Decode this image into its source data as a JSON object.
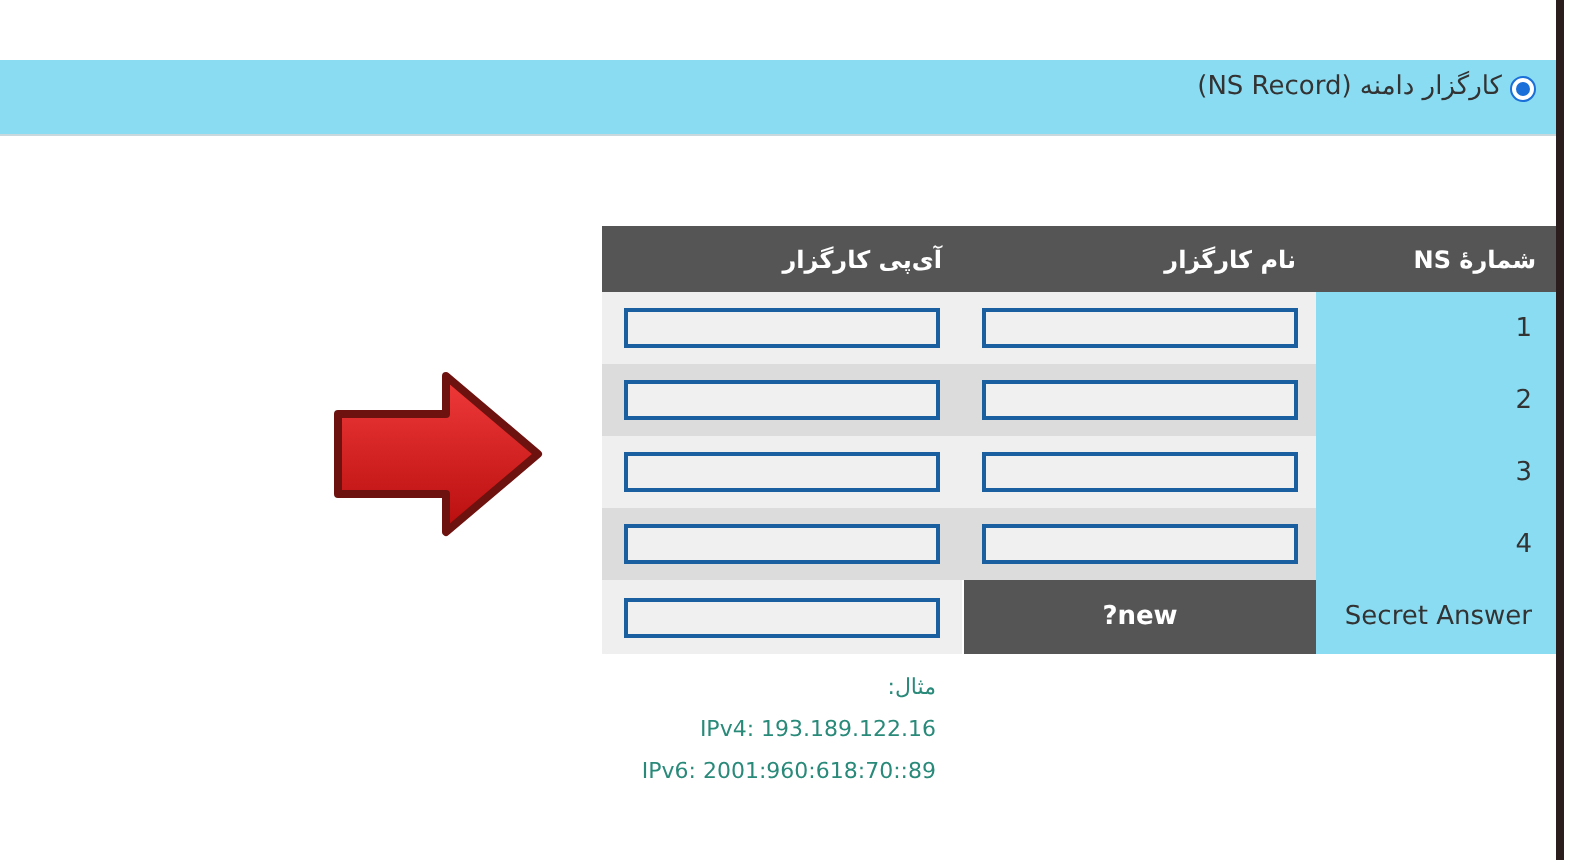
{
  "ns_option": {
    "label": "کارگزار دامنه (NS Record)",
    "selected": true
  },
  "table": {
    "columns": [
      "شمارهٔ NS",
      "نام کارگزار",
      "آی‌پی کارگزار"
    ],
    "rows": [
      {
        "number": "1"
      },
      {
        "number": "2"
      },
      {
        "number": "3"
      },
      {
        "number": "4"
      }
    ],
    "secret_row": {
      "label": "Secret Answer",
      "value": "?new"
    }
  },
  "example": {
    "title": "مثال:",
    "lines": [
      "IPv4: 193.189.122.16",
      "IPv6: 2001:960:618:70::89"
    ]
  }
}
